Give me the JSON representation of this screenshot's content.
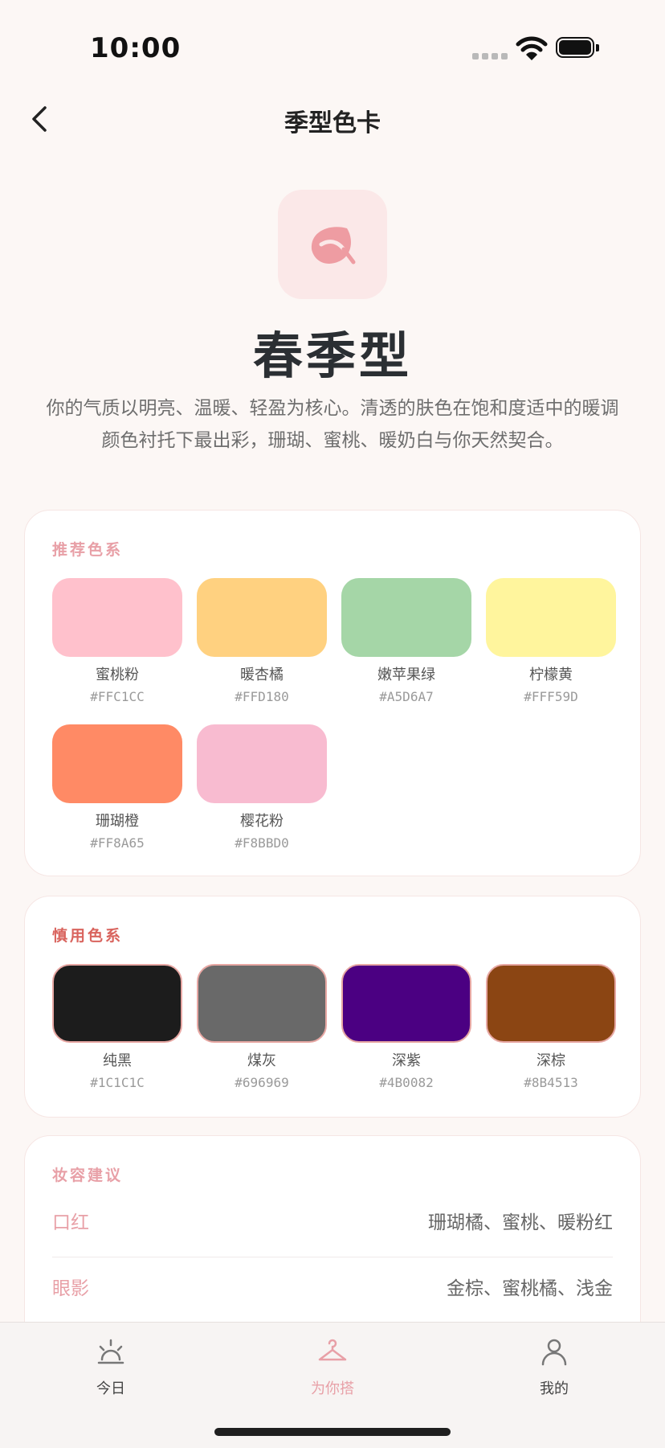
{
  "status_bar": {
    "time": "10:00"
  },
  "nav": {
    "title": "季型色卡",
    "back_icon": "chevron-left-icon"
  },
  "hero": {
    "icon": "leaf-icon",
    "icon_color": "#EE9CA2",
    "season": "春季型",
    "description": "你的气质以明亮、温暖、轻盈为核心。清透的肤色在饱和度适中的暖调颜色衬托下最出彩，珊瑚、蜜桃、暖奶白与你天然契合。"
  },
  "recommended": {
    "title": "推荐色系",
    "title_color": "#E8A0A7",
    "colors": [
      {
        "name": "蜜桃粉",
        "hex": "#FFC1CC"
      },
      {
        "name": "暖杏橘",
        "hex": "#FFD180"
      },
      {
        "name": "嫩苹果绿",
        "hex": "#A5D6A7"
      },
      {
        "name": "柠檬黄",
        "hex": "#FFF59D"
      },
      {
        "name": "珊瑚橙",
        "hex": "#FF8A65"
      },
      {
        "name": "樱花粉",
        "hex": "#F8BBD0"
      }
    ]
  },
  "avoid": {
    "title": "慎用色系",
    "title_color": "#D9645E",
    "border_color": "#E7A7A3",
    "colors": [
      {
        "name": "纯黑",
        "hex": "#1C1C1C"
      },
      {
        "name": "煤灰",
        "hex": "#696969"
      },
      {
        "name": "深紫",
        "hex": "#4B0082"
      },
      {
        "name": "深棕",
        "hex": "#8B4513"
      }
    ]
  },
  "makeup": {
    "title": "妆容建议",
    "items": [
      {
        "label": "口红",
        "value": "珊瑚橘、蜜桃、暖粉红"
      },
      {
        "label": "眼影",
        "value": "金棕、蜜桃橘、浅金"
      }
    ]
  },
  "tabbar": {
    "tabs": [
      {
        "label": "今日",
        "icon": "sunrise-icon"
      },
      {
        "label": "为你搭",
        "icon": "hanger-icon",
        "active": true
      },
      {
        "label": "我的",
        "icon": "user-icon"
      }
    ],
    "accent": "#E8A0A7"
  }
}
